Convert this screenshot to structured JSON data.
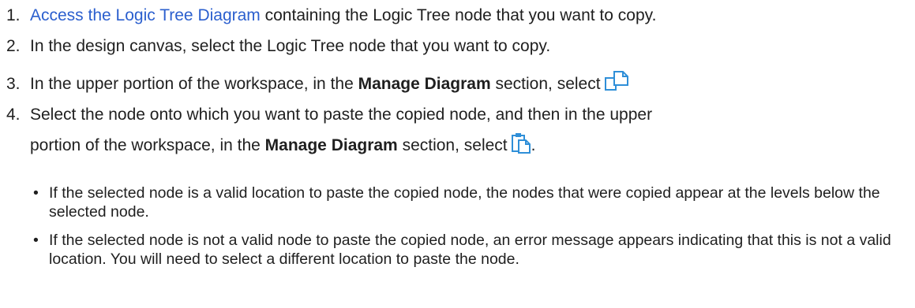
{
  "steps": [
    {
      "num": "1.",
      "link": "Access the Logic Tree Diagram",
      "text": " containing the Logic Tree node that you want to copy."
    },
    {
      "num": "2.",
      "text": "In the design canvas, select the Logic Tree node that you want to copy."
    },
    {
      "num": "3.",
      "pre": "In the upper portion of the workspace, in the ",
      "bold": "Manage Diagram",
      "post": " section, select",
      "icon": "copy-icon"
    },
    {
      "num": "4.",
      "line1": "Select the node onto which you want to paste the copied node, and then in the upper",
      "pre": "portion of the workspace, in the ",
      "bold": "Manage Diagram",
      "post": " section, select",
      "icon": "paste-icon",
      "end": "."
    }
  ],
  "bullets": [
    {
      "dot": "•",
      "text": "If the selected node is a valid location to paste the copied node, the nodes that were copied appear at the levels below the selected node."
    },
    {
      "dot": "•",
      "text": "If the selected node is not a valid node to paste the copied node, an error message appears indicating that this is not a valid location. You will need to select a different location to paste the node."
    }
  ],
  "colors": {
    "link": "#2b5fce",
    "text": "#1f1f1f",
    "icon_blue": "#2f8fd8",
    "icon_fill": "#ffffff"
  }
}
